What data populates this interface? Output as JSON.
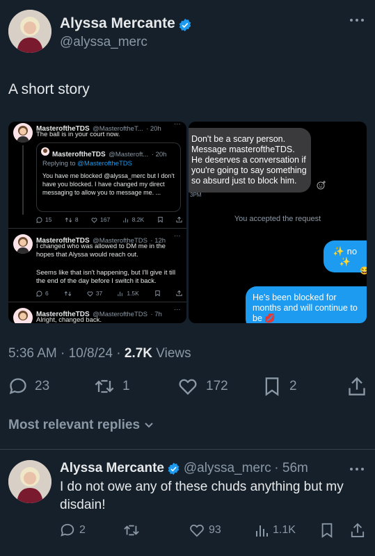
{
  "post": {
    "author_name": "Alyssa Mercante",
    "author_handle": "@alyssa_merc",
    "text": "A short story",
    "timestamp": "5:36 AM · 10/8/24 · ",
    "views_count": "2.7K",
    "views_label": " Views",
    "replies": "23",
    "reposts": "1",
    "likes": "172",
    "bookmarks": "2"
  },
  "embedded_left": {
    "tweet1": {
      "name": "MasteroftheTDS",
      "handle": "@MasteroftheT...",
      "time": "· 20h",
      "text": "The ball is in your court now."
    },
    "quoted": {
      "name": "MasteroftheTDS",
      "handle": "@Masteroft...",
      "time": "· 20h",
      "replying_prefix": "Replying to ",
      "replying_handle": "@MasteroftheTDS",
      "text": "You have me blocked @alyssa_merc but I don't have you blocked. I have changed my direct messaging to allow you to message me. ..."
    },
    "tweet1_metrics": {
      "replies": "15",
      "reposts": "8",
      "likes": "167",
      "views": "8.2K"
    },
    "tweet2": {
      "name": "MasteroftheTDS",
      "handle": "@MasteroftheTDS",
      "time": "· 12h",
      "text1": "I changed who was allowed to DM me in the hopes that Alyssa would reach out.",
      "text2": "Seems like that isn't happening, but I'll give it till the end of the day before I switch it back."
    },
    "tweet2_metrics": {
      "replies": "6",
      "likes": "37",
      "views": "1.5K"
    },
    "tweet3": {
      "name": "MasteroftheTDS",
      "handle": "@MasteroftheTDS",
      "time": "· 7h",
      "text": "Alright, changed back."
    }
  },
  "embedded_right": {
    "incoming": "Don't be a scary person. Message masteroftheTDS. He deserves a conversation if you're going to say something so absurd just to block him.",
    "incoming_time": "3PM",
    "accepted": "You accepted the request",
    "outgoing1": "✨ no ✨",
    "reaction1": "😂",
    "outgoing2": "He's been blocked for months and will continue to be 💋"
  },
  "replies_header": "Most relevant replies",
  "reply": {
    "author_name": "Alyssa Mercante",
    "author_handle": "@alyssa_merc",
    "time": "· 56m",
    "text": "I do not owe any of these chuds anything but my disdain!",
    "replies": "2",
    "likes": "93",
    "views": "1.1K"
  },
  "colors": {
    "background": "#15202b",
    "accent": "#1d9bf0",
    "muted": "#8b98a5",
    "like_pink": "#f91880"
  }
}
